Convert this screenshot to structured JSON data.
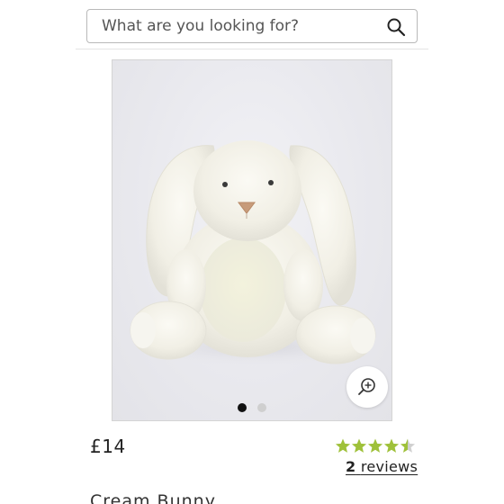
{
  "search": {
    "placeholder": "What are you looking for?",
    "icon": "search-icon"
  },
  "gallery": {
    "image_alt": "Cream Bunny plush toy",
    "zoom_icon": "zoom-in-icon",
    "dots_total": 2,
    "active_dot": 1
  },
  "product": {
    "price": "£14",
    "title": "Cream Bunny",
    "rating": {
      "value": 4.5,
      "max": 5,
      "star_color": "#9fc13a",
      "empty_color": "#d0d0d0"
    },
    "reviews_count": "2",
    "reviews_label": "reviews"
  }
}
